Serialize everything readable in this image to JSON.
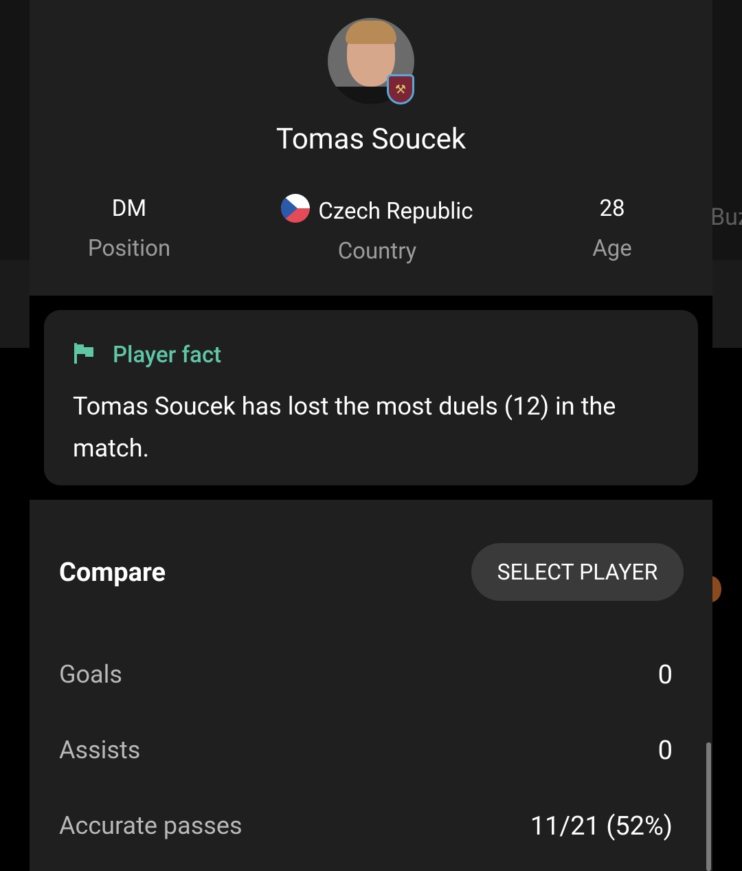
{
  "background": {
    "peek_text": "Buz"
  },
  "player": {
    "name": "Tomas Soucek",
    "position_value": "DM",
    "position_label": "Position",
    "country_value": "Czech Republic",
    "country_label": "Country",
    "age_value": "28",
    "age_label": "Age"
  },
  "fact": {
    "title": "Player fact",
    "text": "Tomas Soucek has lost the most duels (12) in the match."
  },
  "compare": {
    "title": "Compare",
    "select_button": "SELECT PLAYER",
    "stats": [
      {
        "label": "Goals",
        "value": "0"
      },
      {
        "label": "Assists",
        "value": "0"
      },
      {
        "label": "Accurate passes",
        "value": "11/21 (52%)"
      }
    ]
  },
  "colors": {
    "accent": "#5fc6a6",
    "card": "#1f1f1f",
    "muted_text": "#9c9c9c"
  }
}
